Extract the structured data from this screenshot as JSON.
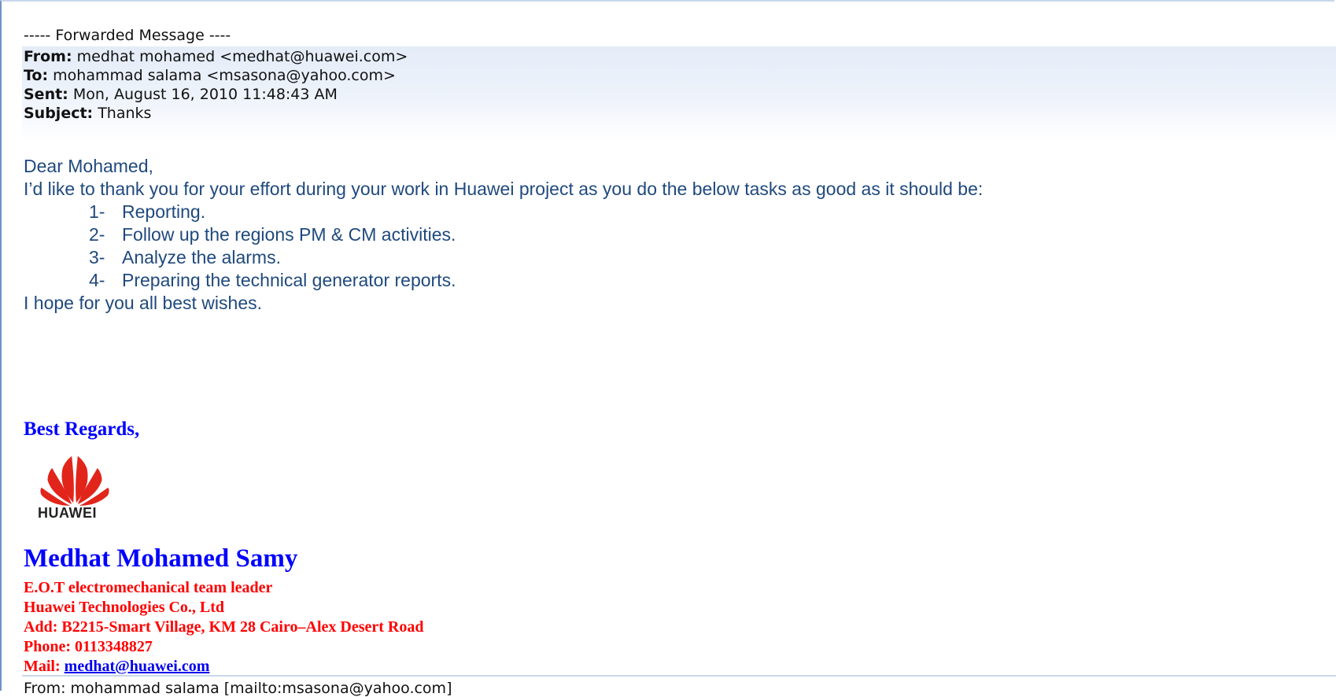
{
  "forwarded_header": "----- Forwarded Message ----",
  "headers": {
    "from_label": "From:",
    "from_value": "medhat mohamed <medhat@huawei.com>",
    "to_label": "To:",
    "to_value": "mohammad salama <msasona@yahoo.com>",
    "sent_label": "Sent:",
    "sent_value": "Mon, August 16, 2010 11:48:43 AM",
    "subject_label": "Subject:",
    "subject_value": "Thanks"
  },
  "body": {
    "greeting": "Dear Mohamed,",
    "intro": "I’d like to thank you for your effort during your work in Huawei project as you do the below tasks as good as it should be:",
    "tasks": [
      {
        "num": "1-",
        "text": "Reporting."
      },
      {
        "num": "2-",
        "text": "Follow up the regions PM & CM activities."
      },
      {
        "num": "3-",
        "text": "Analyze the alarms."
      },
      {
        "num": "4-",
        "text": "Preparing the technical generator reports."
      }
    ],
    "closing": "I hope for you all best wishes."
  },
  "signature": {
    "regards": "Best Regards,",
    "logo_text": "HUAWEI",
    "name": "Medhat Mohamed Samy",
    "title": "E.O.T electromechanical team leader",
    "company": "Huawei Technologies Co., Ltd",
    "address": "Add: B2215-Smart Village, KM 28 Cairo–Alex Desert Road",
    "phone": "Phone: 0113348827",
    "mail_label": "Mail: ",
    "mail_link": "medhat@huawei.com"
  },
  "next_message_line": "From: mohammad salama [mailto:msasona@yahoo.com]",
  "colors": {
    "body_text": "#1f497d",
    "signature_blue": "#0000ff",
    "signature_red": "#ff0000",
    "logo_red": "#e1251b"
  }
}
